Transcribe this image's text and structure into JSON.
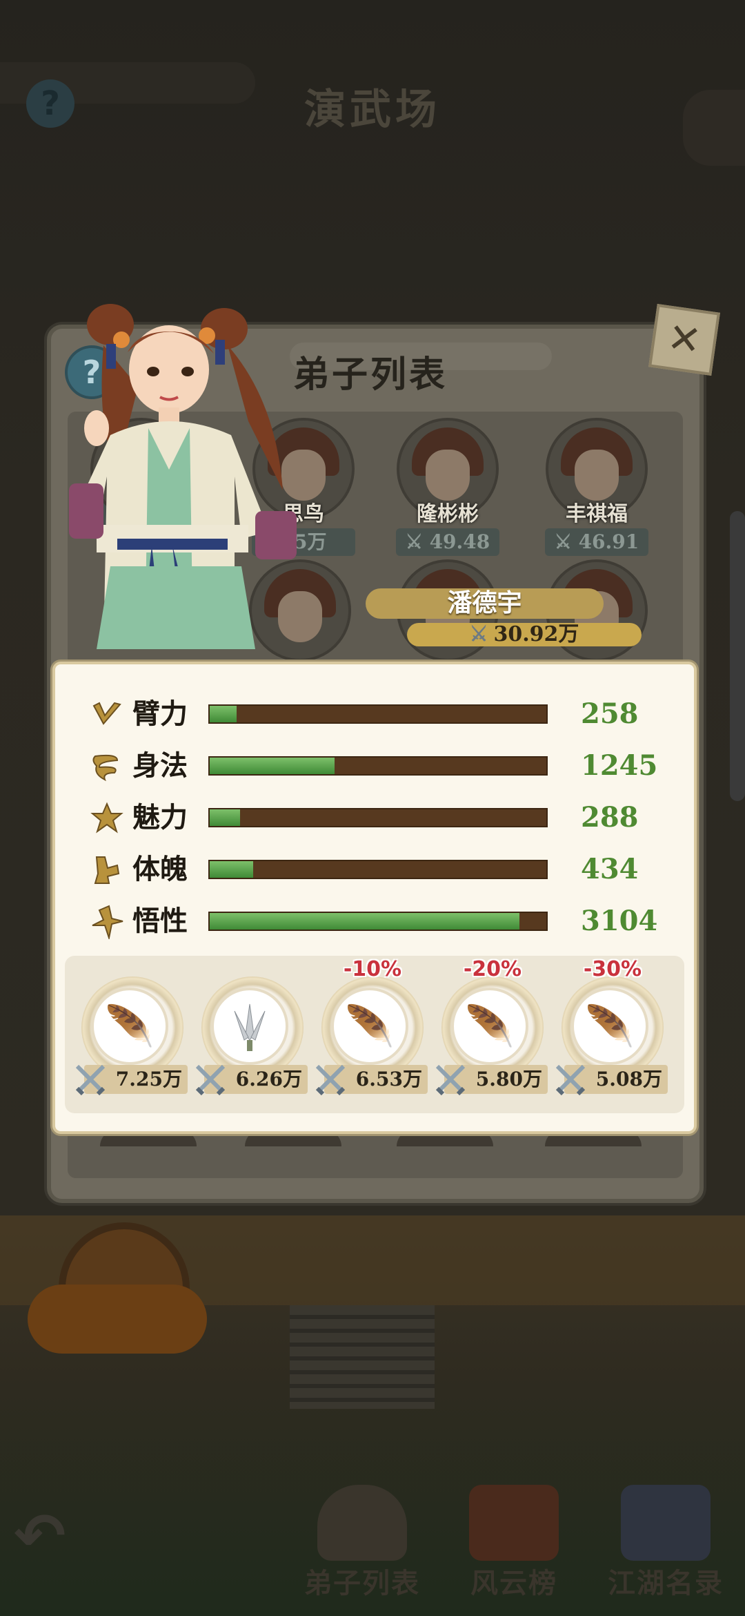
{
  "screen": {
    "title": "演武场"
  },
  "dialog": {
    "title": "弟子列表",
    "help_icon": "question-mark-icon",
    "close_icon": "close-icon",
    "disciples": [
      {
        "name": "",
        "power": ""
      },
      {
        "name": "思鸟",
        "power": "15万"
      },
      {
        "name": "隆彬彬",
        "power": "49.48万"
      },
      {
        "name": "丰祺福",
        "power": "46.91万"
      },
      {
        "name": "",
        "power": ""
      },
      {
        "name": "",
        "power": ""
      },
      {
        "name": "",
        "power": ""
      },
      {
        "name": "",
        "power": ""
      }
    ],
    "selected": {
      "name": "潘德宇",
      "power": "30.92万"
    }
  },
  "stats": [
    {
      "label": "臂力",
      "value": "258",
      "fill": 0.08,
      "icon": "arm-strength-icon"
    },
    {
      "label": "身法",
      "value": "1245",
      "fill": 0.37,
      "icon": "agility-icon"
    },
    {
      "label": "魅力",
      "value": "288",
      "fill": 0.09,
      "icon": "charm-icon"
    },
    {
      "label": "体魄",
      "value": "434",
      "fill": 0.13,
      "icon": "physique-icon"
    },
    {
      "label": "悟性",
      "value": "3104",
      "fill": 0.92,
      "icon": "comprehension-icon"
    }
  ],
  "equipment": [
    {
      "icon": "feather-icon",
      "cost": "7.25万",
      "discount": ""
    },
    {
      "icon": "throwing-knives-icon",
      "cost": "6.26万",
      "discount": ""
    },
    {
      "icon": "feather-icon",
      "cost": "6.53万",
      "discount": "-10%"
    },
    {
      "icon": "feather-icon",
      "cost": "5.80万",
      "discount": "-20%"
    },
    {
      "icon": "feather-icon",
      "cost": "5.08万",
      "discount": "-30%"
    }
  ],
  "nav": {
    "back_icon": "back-arrow-icon",
    "items": [
      {
        "label": "弟子列表",
        "icon": "disciple-icon"
      },
      {
        "label": "风云榜",
        "icon": "ranking-scroll-icon"
      },
      {
        "label": "江湖名录",
        "icon": "book-icon"
      }
    ]
  }
}
